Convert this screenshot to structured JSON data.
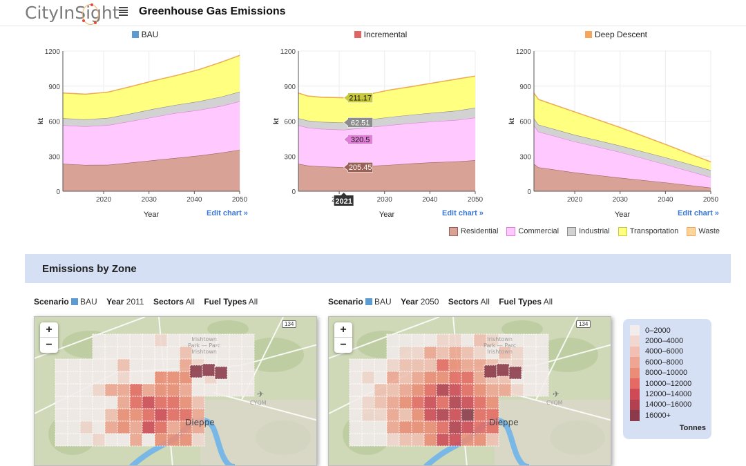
{
  "header": {
    "logo_text": "CityInSight",
    "menu_icon": "hamburger-icon",
    "title": "Greenhouse Gas Emissions"
  },
  "colors": {
    "bau": "#5b9bd1",
    "incremental": "#e06666",
    "deep_descent": "#f6a55a",
    "link": "#3b78d8",
    "banner": "#d6e0f5"
  },
  "chart_data": [
    {
      "type": "area",
      "stacked": true,
      "title": "BAU",
      "title_color": "#5b9bd1",
      "xlabel": "Year",
      "ylabel": "kt",
      "xlim": [
        2011,
        2050
      ],
      "ylim": [
        0,
        1200
      ],
      "yticks": [
        0,
        300,
        600,
        900,
        1200
      ],
      "xticks": [
        2020,
        2030,
        2040,
        2050
      ],
      "grid": true,
      "x": [
        2011,
        2016,
        2021,
        2026,
        2031,
        2036,
        2041,
        2046,
        2050
      ],
      "series": [
        {
          "name": "Residential",
          "values": [
            235,
            225,
            226,
            245,
            265,
            285,
            305,
            330,
            355
          ]
        },
        {
          "name": "Commercial",
          "values": [
            330,
            330,
            340,
            355,
            370,
            385,
            390,
            400,
            415
          ]
        },
        {
          "name": "Industrial",
          "values": [
            60,
            60,
            62,
            65,
            70,
            70,
            75,
            80,
            82
          ]
        },
        {
          "name": "Transportation",
          "values": [
            215,
            215,
            220,
            230,
            240,
            250,
            270,
            295,
            310
          ]
        },
        {
          "name": "Waste",
          "values": [
            2,
            2,
            2,
            2,
            2,
            2,
            2,
            2,
            2
          ]
        }
      ],
      "edit_label": "Edit chart »"
    },
    {
      "type": "area",
      "stacked": true,
      "title": "Incremental",
      "title_color": "#e06666",
      "xlabel": "Year",
      "ylabel": "kt",
      "xlim": [
        2011,
        2050
      ],
      "ylim": [
        0,
        1200
      ],
      "yticks": [
        0,
        300,
        600,
        900,
        1200
      ],
      "xticks": [
        2020,
        2030,
        2040,
        2050
      ],
      "grid": true,
      "x": [
        2011,
        2013,
        2016,
        2021,
        2026,
        2031,
        2036,
        2041,
        2046,
        2050
      ],
      "series": [
        {
          "name": "Residential",
          "values": [
            235,
            220,
            212,
            205.45,
            215,
            225,
            238,
            248,
            255,
            265
          ]
        },
        {
          "name": "Commercial",
          "values": [
            330,
            325,
            322,
            320.5,
            330,
            340,
            345,
            350,
            355,
            365
          ]
        },
        {
          "name": "Industrial",
          "values": [
            60,
            60,
            60,
            62.51,
            65,
            70,
            72,
            75,
            80,
            85
          ]
        },
        {
          "name": "Transportation",
          "values": [
            215,
            210,
            210,
            211.17,
            215,
            230,
            240,
            255,
            270,
            270
          ]
        },
        {
          "name": "Waste",
          "values": [
            2,
            2,
            2,
            2,
            2,
            2,
            2,
            2,
            2,
            2
          ]
        }
      ],
      "hover": {
        "year_label": "2021",
        "labels": [
          {
            "series": "Transportation",
            "value": "211.17"
          },
          {
            "series": "Industrial",
            "value": "62.51"
          },
          {
            "series": "Commercial",
            "value": "320.5"
          },
          {
            "series": "Residential",
            "value": "205.45"
          }
        ]
      },
      "edit_label": "Edit chart »"
    },
    {
      "type": "area",
      "stacked": true,
      "title": "Deep Descent",
      "title_color": "#f6a55a",
      "xlabel": "Year",
      "ylabel": "kt",
      "xlim": [
        2011,
        2050
      ],
      "ylim": [
        0,
        1200
      ],
      "yticks": [
        0,
        300,
        600,
        900,
        1200
      ],
      "xticks": [
        2020,
        2030,
        2040,
        2050
      ],
      "grid": true,
      "x": [
        2011,
        2012,
        2020,
        2030,
        2040,
        2050
      ],
      "series": [
        {
          "name": "Residential",
          "values": [
            235,
            205,
            160,
            115,
            75,
            30
          ]
        },
        {
          "name": "Commercial",
          "values": [
            330,
            305,
            265,
            220,
            155,
            90
          ]
        },
        {
          "name": "Industrial",
          "values": [
            60,
            60,
            58,
            55,
            60,
            60
          ]
        },
        {
          "name": "Transportation",
          "values": [
            215,
            215,
            195,
            155,
            110,
            70
          ]
        },
        {
          "name": "Waste",
          "values": [
            2,
            2,
            2,
            2,
            2,
            2
          ]
        }
      ],
      "edit_label": "Edit chart »"
    }
  ],
  "sector_legend": [
    {
      "name": "Residential",
      "fill": "#d8a396",
      "stroke": "#9a6257"
    },
    {
      "name": "Commercial",
      "fill": "#ffc8ff",
      "stroke": "#e07fd8"
    },
    {
      "name": "Industrial",
      "fill": "#d2d2d2",
      "stroke": "#8c8c8c"
    },
    {
      "name": "Transportation",
      "fill": "#ffff80",
      "stroke": "#c8c83c"
    },
    {
      "name": "Waste",
      "fill": "#ffd699",
      "stroke": "#f6a55a"
    }
  ],
  "zones": {
    "title": "Emissions by Zone",
    "maps": [
      {
        "filters": {
          "scenario_label": "Scenario",
          "scenario": "BAU",
          "year_label": "Year",
          "year": "2011",
          "sectors_label": "Sectors",
          "sectors": "All",
          "fuel_label": "Fuel Types",
          "fuel": "All"
        },
        "zoom_in": "+",
        "zoom_out": "−",
        "labels": {
          "city": "Dieppe",
          "airport": "CYQM",
          "park1": "Irishtown",
          "park2": "Park — Parc",
          "park3": "Irishtown",
          "route": "134"
        }
      },
      {
        "filters": {
          "scenario_label": "Scenario",
          "scenario": "BAU",
          "year_label": "Year",
          "year": "2050",
          "sectors_label": "Sectors",
          "sectors": "All",
          "fuel_label": "Fuel Types",
          "fuel": "All"
        },
        "zoom_in": "+",
        "zoom_out": "−",
        "labels": {
          "city": "Dieppe",
          "airport": "CYQM",
          "park1": "Irishtown",
          "park2": "Park — Parc",
          "park3": "Irishtown",
          "route": "134"
        }
      }
    ],
    "legend": {
      "bins": [
        {
          "label": "0–2000",
          "color": "#f3ecec"
        },
        {
          "label": "2000–4000",
          "color": "#f2d7d0"
        },
        {
          "label": "4000–6000",
          "color": "#f1c0b2"
        },
        {
          "label": "6000–8000",
          "color": "#eea692"
        },
        {
          "label": "8000–10000",
          "color": "#eb8c76"
        },
        {
          "label": "10000–12000",
          "color": "#e46a63"
        },
        {
          "label": "12000–14000",
          "color": "#cf4a57"
        },
        {
          "label": "14000–16000",
          "color": "#b3404f"
        },
        {
          "label": "16000+",
          "color": "#8a3a4a"
        }
      ],
      "unit": "Tonnes"
    }
  }
}
